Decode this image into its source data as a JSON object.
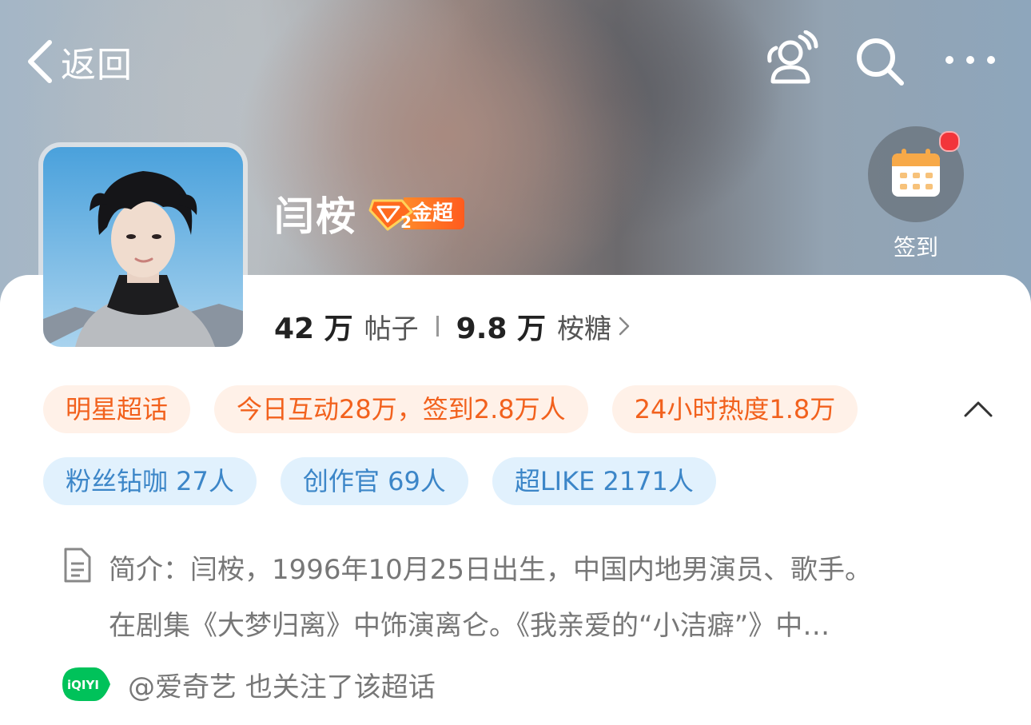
{
  "header": {
    "back_label": "返回",
    "back_icon": "chevron-left-icon",
    "people_icon": "people-icon",
    "search_icon": "search-icon",
    "more_icon": "more-dots-icon"
  },
  "topic": {
    "title": "闫桉",
    "level_number": "2",
    "level_label": "金超",
    "checkin_label": "签到",
    "checkin_icon": "calendar-icon"
  },
  "stats": {
    "posts_value": "42 万",
    "posts_label": "帖子",
    "candy_value": "9.8 万",
    "candy_label": "桉糖"
  },
  "tags_row1": [
    "明星超话",
    "今日互动28万，签到2.8万人",
    "24小时热度1.8万"
  ],
  "tags_row2": [
    "粉丝钻咖 27人",
    "创作官 69人",
    "超LIKE 2171人"
  ],
  "intro": {
    "line1": "简介：闫桉，1996年10月25日出生，中国内地男演员、歌手。",
    "line2": "在剧集《大梦归离》中饰演离仑。《我亲爱的“小洁癖”》中…"
  },
  "follow": {
    "logo_text": "iQIYI",
    "text": "@爱奇艺 也关注了该超话"
  },
  "colors": {
    "orange_tag_bg": "#fff1e8",
    "orange_tag_text": "#f2611d",
    "blue_tag_bg": "#e1f1fd",
    "blue_tag_text": "#3c86c8",
    "red_dot": "#f2353a"
  }
}
